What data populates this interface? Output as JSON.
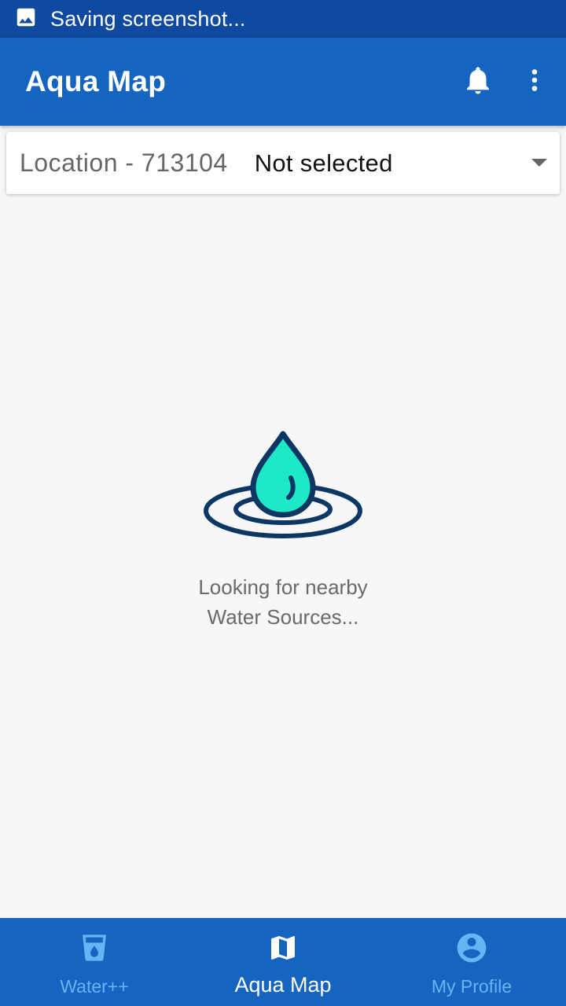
{
  "status_bar": {
    "text": "Saving screenshot...",
    "icon": "image-icon"
  },
  "app_bar": {
    "title": "Aqua Map",
    "actions": [
      "bell-icon",
      "more-vert-icon"
    ]
  },
  "location_selector": {
    "label": "Location - 713104",
    "selected_value": "Not selected",
    "icon": "dropdown-arrow-icon"
  },
  "loading_state": {
    "icon": "water-drop-ripple-icon",
    "message_line_1": "Looking for nearby",
    "message_line_2": "Water Sources..."
  },
  "bottom_nav": {
    "items": [
      {
        "label": "Water++",
        "icon": "water-glass-icon",
        "active": false
      },
      {
        "label": "Aqua Map",
        "icon": "map-icon",
        "active": true
      },
      {
        "label": "My Profile",
        "icon": "account-circle-icon",
        "active": false
      }
    ]
  },
  "colors": {
    "status_bar": "#0f4aa0",
    "primary": "#1565c0",
    "inactive_nav": "#64b5f6",
    "drop_fill": "#1de9c8",
    "drop_outline": "#0d3763",
    "background": "#f7f7f7"
  }
}
